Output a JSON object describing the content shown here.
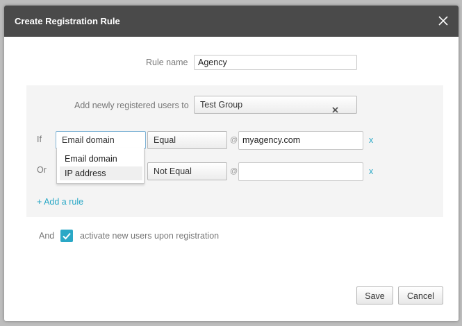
{
  "dialog": {
    "title": "Create Registration Rule",
    "close_icon": "close-icon"
  },
  "rule_name": {
    "label": "Rule name",
    "value": "Agency"
  },
  "group": {
    "label": "Add newly registered users to",
    "value": "Test Group",
    "clear_icon": "clear-x-icon"
  },
  "rules": [
    {
      "prefix": "If",
      "field": "Email domain",
      "operator": "Equal",
      "at": "@",
      "value": "myagency.com",
      "remove": "x"
    },
    {
      "prefix": "Or",
      "field": "IP address",
      "operator": "Not Equal",
      "at": "@",
      "value": "",
      "remove": "x"
    }
  ],
  "field_dropdown": {
    "options": [
      "Email domain",
      "IP address"
    ],
    "highlighted": "IP address"
  },
  "add_rule_label": "+ Add a rule",
  "activate": {
    "prefix": "And",
    "label": "activate new users upon registration",
    "checked": true
  },
  "buttons": {
    "save": "Save",
    "cancel": "Cancel"
  },
  "colors": {
    "accent": "#2aa8c6",
    "titlebar": "#4a4a4a"
  }
}
